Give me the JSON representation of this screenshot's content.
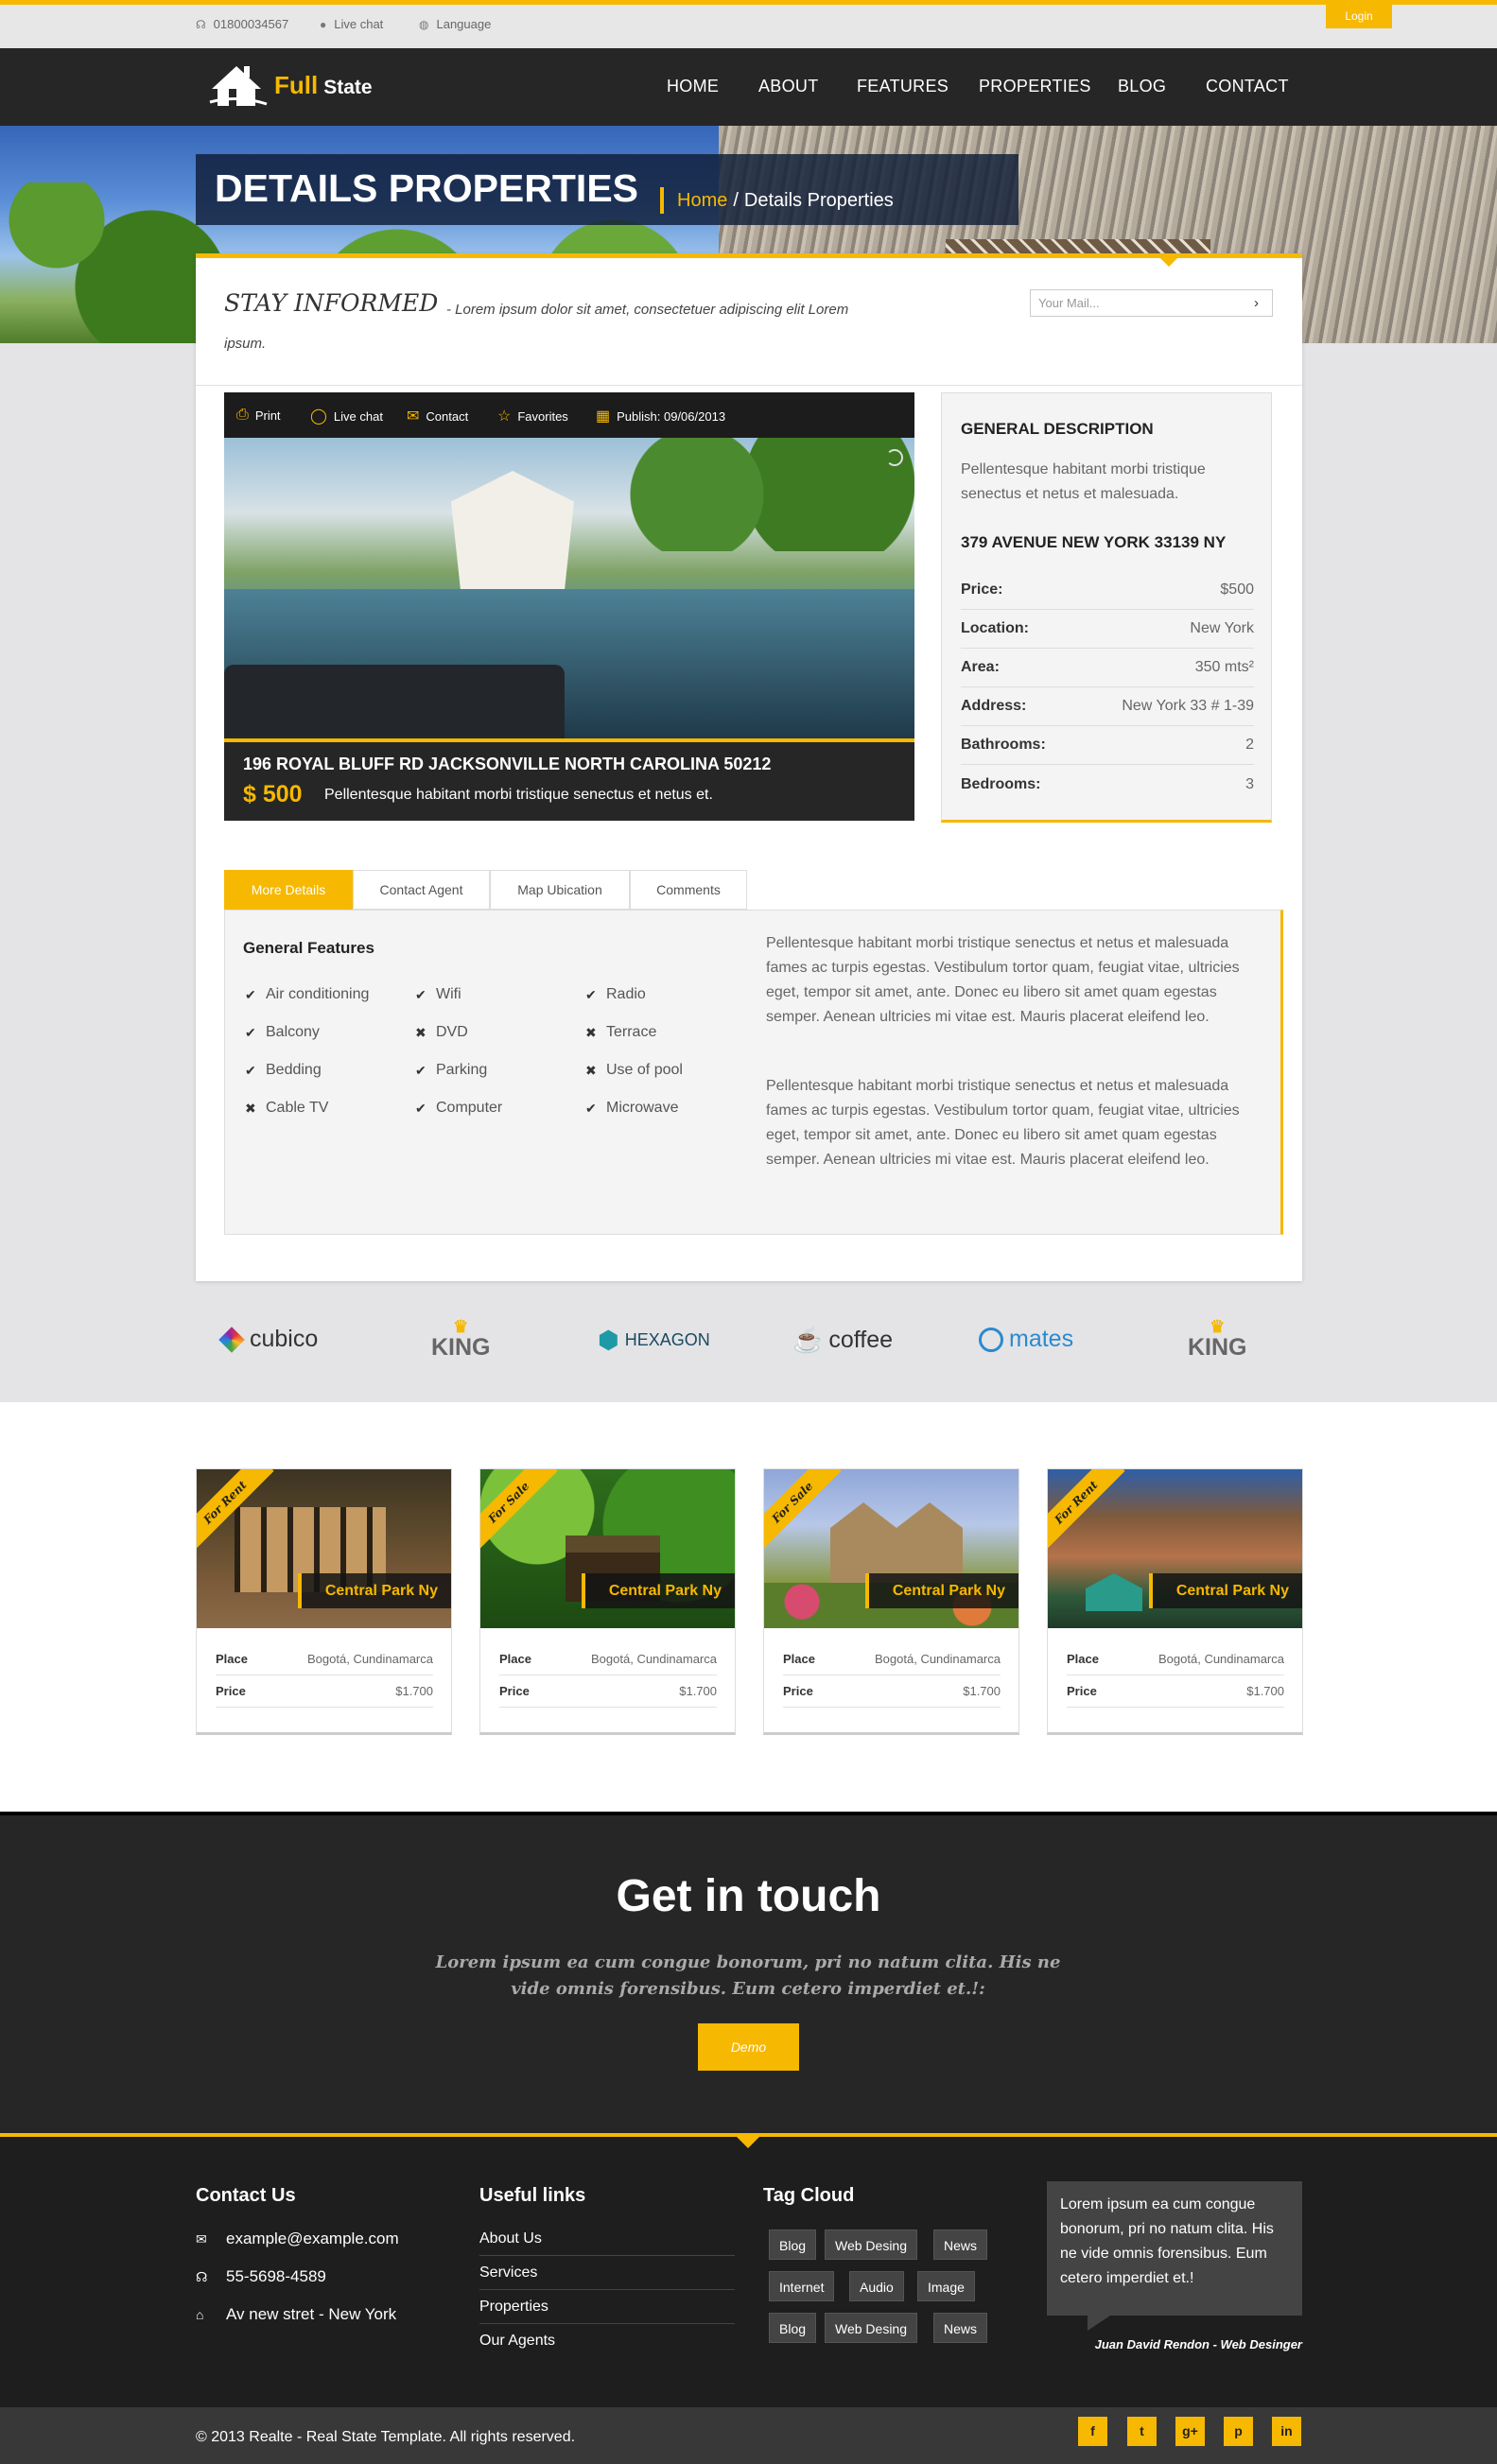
{
  "topbar": {
    "phone": "01800034567",
    "live_chat": "Live chat",
    "language": "Language",
    "login": "Login"
  },
  "brand": {
    "first": "Full",
    "second": "State"
  },
  "nav": [
    "HOME",
    "ABOUT",
    "FEATURES",
    "PROPERTIES",
    "BLOG",
    "CONTACT"
  ],
  "hero": {
    "title": "DETAILS PROPERTIES",
    "crumb_home": "Home",
    "crumb_sep": "/",
    "crumb_current": "Details Properties"
  },
  "newsletter": {
    "title": "STAY INFORMED",
    "text": "- Lorem ipsum dolor sit amet, consectetuer adipiscing elit Lorem ipsum.",
    "placeholder": "Your Mail...",
    "submit_icon": "chevron-right-icon"
  },
  "gallery_bar": {
    "print": "Print",
    "live_chat": "Live chat",
    "contact": "Contact",
    "favorites": "Favorites",
    "publish": "Publish: 09/06/2013"
  },
  "property": {
    "address": "196 ROYAL BLUFF RD JACKSONVILLE NORTH CAROLINA 50212",
    "price": "$ 500",
    "caption": "Pellentesque habitant morbi tristique senectus et netus et."
  },
  "general": {
    "title": "GENERAL DESCRIPTION",
    "text": "Pellentesque habitant morbi tristique senectus et netus et malesuada.",
    "address": "379 AVENUE NEW YORK 33139 NY",
    "rows": [
      {
        "label": "Price:",
        "value": "$500"
      },
      {
        "label": "Location:",
        "value": "New York"
      },
      {
        "label": "Area:",
        "value": "350 mts²"
      },
      {
        "label": "Address:",
        "value": "New York 33 # 1-39"
      },
      {
        "label": "Bathrooms:",
        "value": "2"
      },
      {
        "label": "Bedrooms:",
        "value": "3"
      }
    ]
  },
  "tabs": [
    "More Details",
    "Contact Agent",
    "Map Ubication",
    "Comments"
  ],
  "features": {
    "title": "General Features",
    "items": [
      {
        "label": "Air conditioning",
        "ok": true
      },
      {
        "label": "Wifi",
        "ok": true
      },
      {
        "label": "Radio",
        "ok": true
      },
      {
        "label": "Balcony",
        "ok": true
      },
      {
        "label": "DVD",
        "ok": false
      },
      {
        "label": "Terrace",
        "ok": false
      },
      {
        "label": "Bedding",
        "ok": true
      },
      {
        "label": "Parking",
        "ok": true
      },
      {
        "label": "Use of pool",
        "ok": false
      },
      {
        "label": "Cable TV",
        "ok": false
      },
      {
        "label": "Computer",
        "ok": true
      },
      {
        "label": "Microwave",
        "ok": true
      }
    ],
    "paragraphs": [
      "Pellentesque habitant morbi tristique senectus et netus et malesuada fames ac turpis egestas. Vestibulum tortor quam, feugiat vitae, ultricies eget, tempor sit amet, ante. Donec eu libero sit amet quam egestas semper. Aenean ultricies mi vitae est. Mauris placerat eleifend leo.",
      "Pellentesque habitant morbi tristique senectus et netus et malesuada fames ac turpis egestas. Vestibulum tortor quam, feugiat vitae, ultricies eget, tempor sit amet, ante. Donec eu libero sit amet quam egestas semper. Aenean ultricies mi vitae est. Mauris placerat eleifend leo."
    ]
  },
  "partners": [
    "cubico",
    "KING",
    "HEXAGON",
    "coffee",
    "mates",
    "KING"
  ],
  "listings": [
    {
      "ribbon": "For Rent",
      "name": "Central Park Ny",
      "place_label": "Place",
      "place": "Bogotá, Cundinamarca",
      "price_label": "Price",
      "price": "$1.700"
    },
    {
      "ribbon": "For Sale",
      "name": "Central Park Ny",
      "place_label": "Place",
      "place": "Bogotá, Cundinamarca",
      "price_label": "Price",
      "price": "$1.700"
    },
    {
      "ribbon": "For Sale",
      "name": "Central Park Ny",
      "place_label": "Place",
      "place": "Bogotá, Cundinamarca",
      "price_label": "Price",
      "price": "$1.700"
    },
    {
      "ribbon": "For Rent",
      "name": "Central Park Ny",
      "place_label": "Place",
      "place": "Bogotá, Cundinamarca",
      "price_label": "Price",
      "price": "$1.700"
    }
  ],
  "touch": {
    "title": "Get in touch",
    "text": "Lorem ipsum ea cum congue bonorum, pri no natum clita. His ne vide omnis forensibus. Eum cetero imperdiet et.!:",
    "button": "Demo"
  },
  "footer": {
    "contact_title": "Contact Us",
    "email": "example@example.com",
    "phone": "55-5698-4589",
    "address": "Av new stret - New York",
    "links_title": "Useful links",
    "links": [
      "About Us",
      "Services",
      "Properties",
      "Our Agents"
    ],
    "tags_title": "Tag Cloud",
    "tags": [
      "Blog",
      "Web Desing",
      "News",
      "Internet",
      "Audio",
      "Image",
      "Blog",
      "Web Desing",
      "News"
    ],
    "quote": "Lorem ipsum ea cum congue bonorum, pri no natum clita. His ne vide omnis forensibus. Eum cetero imperdiet et.!",
    "quote_author": "Juan David Rendon - Web Desinger",
    "copyright": "© 2013 Realte - Real State Template. All rights reserved.",
    "social": [
      "f",
      "t",
      "g+",
      "p",
      "in"
    ]
  },
  "colors": {
    "accent": "#f6b800",
    "dark": "#262626",
    "footer": "#1e1e1e"
  }
}
